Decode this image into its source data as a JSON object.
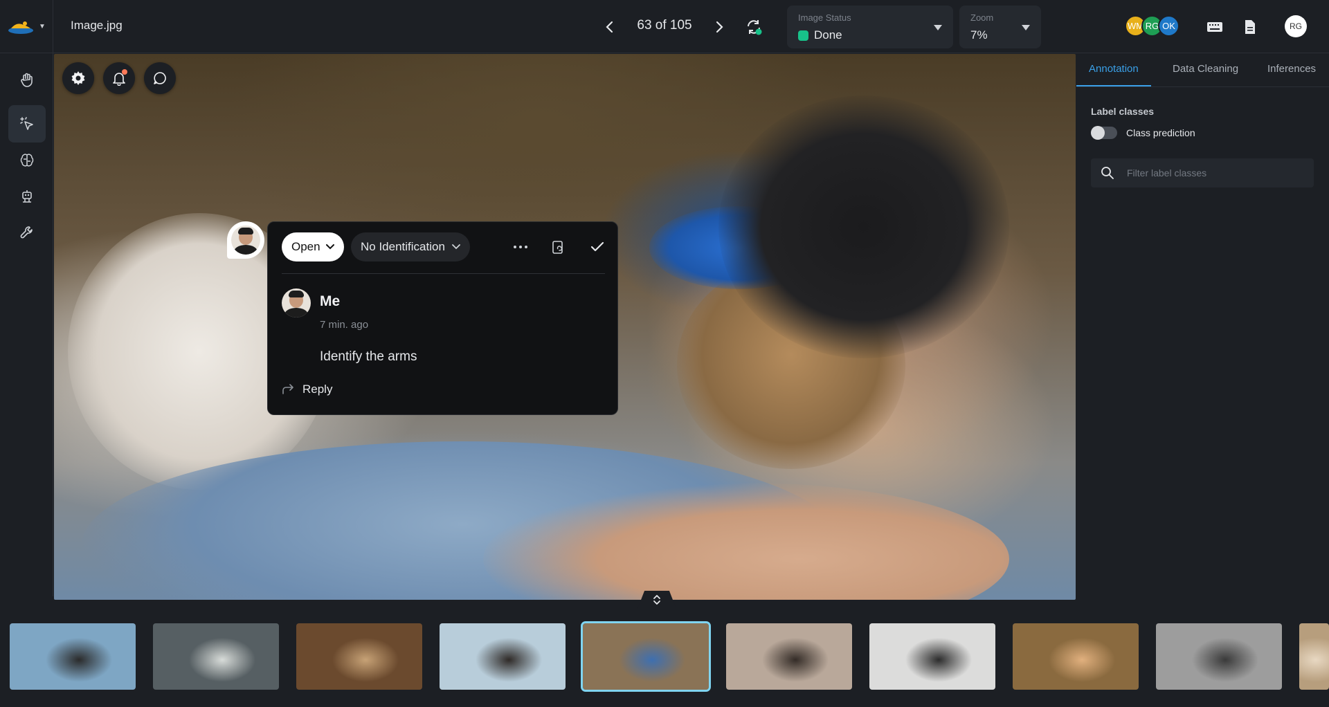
{
  "header": {
    "filename": "Image.jpg",
    "counter": "63 of 105",
    "image_status": {
      "label": "Image Status",
      "value": "Done",
      "color": "#18c28a"
    },
    "zoom": {
      "label": "Zoom",
      "value": "7%"
    },
    "collaborators": [
      {
        "initials": "WM",
        "color": "#e8b01a"
      },
      {
        "initials": "RG",
        "color": "#1e9e54"
      },
      {
        "initials": "OK",
        "color": "#1f79c9"
      }
    ],
    "user_initials": "RG"
  },
  "tools": [
    {
      "icon": "hand-icon"
    },
    {
      "icon": "select-pointer-icon"
    },
    {
      "icon": "brain-icon"
    },
    {
      "icon": "robot-icon"
    },
    {
      "icon": "wrench-icon"
    }
  ],
  "comment": {
    "status": "Open",
    "identification": "No Identification",
    "author": "Me",
    "time": "7 min. ago",
    "text": "Identify the arms",
    "reply_label": "Reply"
  },
  "right_panel": {
    "tabs": [
      "Annotation",
      "Data Cleaning",
      "Inferences"
    ],
    "label_classes_heading": "Label classes",
    "class_prediction_label": "Class prediction",
    "filter_placeholder": "Filter label classes"
  },
  "filmstrip": {
    "active_index": 4,
    "thumbnails": [
      {
        "bg": "#7ea6c4",
        "accent": "#2b2b2b"
      },
      {
        "bg": "#565f63",
        "accent": "#d8dcd9"
      },
      {
        "bg": "#6b4a2e",
        "accent": "#c7a276"
      },
      {
        "bg": "#b8cdda",
        "accent": "#2f2a27"
      },
      {
        "bg": "#8a7356",
        "accent": "#3e6fb0"
      },
      {
        "bg": "#b9a89a",
        "accent": "#342c27"
      },
      {
        "bg": "#dcdcdb",
        "accent": "#2c2c2c"
      },
      {
        "bg": "#8a6a3f",
        "accent": "#e1b07e"
      },
      {
        "bg": "#9d9d9d",
        "accent": "#3a3a3a"
      },
      {
        "bg": "#b79e7d",
        "accent": "#e8d8c2"
      }
    ]
  }
}
